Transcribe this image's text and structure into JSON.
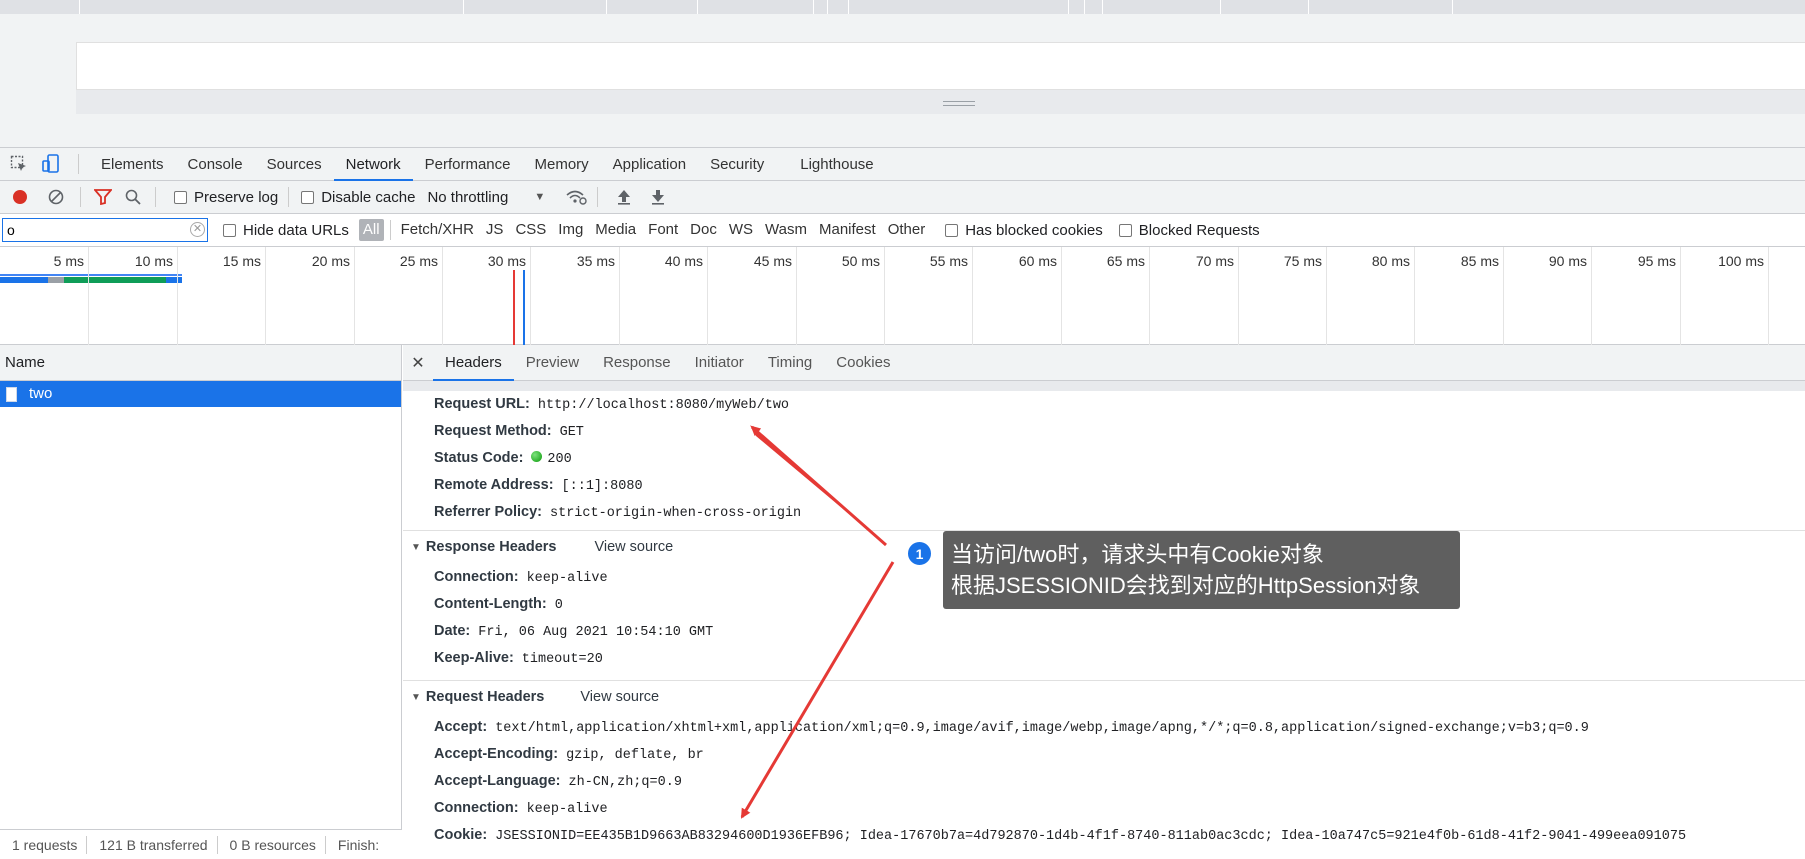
{
  "tabbar": {
    "tabs": [
      "Elements",
      "Console",
      "Sources",
      "Network",
      "Performance",
      "Memory",
      "Application",
      "Security",
      "Lighthouse"
    ],
    "active": "Network"
  },
  "toolbar": {
    "preserve_log": "Preserve log",
    "disable_cache": "Disable cache",
    "throttling": "No throttling"
  },
  "filterbar": {
    "filter_value": "o",
    "hide_data_urls": "Hide data URLs",
    "types": [
      "All",
      "Fetch/XHR",
      "JS",
      "CSS",
      "Img",
      "Media",
      "Font",
      "Doc",
      "WS",
      "Wasm",
      "Manifest",
      "Other"
    ],
    "has_blocked_cookies": "Has blocked cookies",
    "blocked_requests": "Blocked Requests"
  },
  "timeline": {
    "labels": [
      "5 ms",
      "10 ms",
      "15 ms",
      "20 ms",
      "25 ms",
      "30 ms",
      "35 ms",
      "40 ms",
      "45 ms",
      "50 ms",
      "55 ms",
      "60 ms",
      "65 ms",
      "70 ms",
      "75 ms",
      "80 ms",
      "85 ms",
      "90 ms",
      "95 ms",
      "100 ms"
    ]
  },
  "reqlist": {
    "header": "Name",
    "rows": [
      "two"
    ]
  },
  "statusbar": {
    "requests": "1 requests",
    "transferred": "121 B transferred",
    "resources": "0 B resources",
    "finish": "Finish:"
  },
  "details": {
    "tabs": [
      "Headers",
      "Preview",
      "Response",
      "Initiator",
      "Timing",
      "Cookies"
    ],
    "general": [
      {
        "k": "Request URL:",
        "v": "http://localhost:8080/myWeb/two"
      },
      {
        "k": "Request Method:",
        "v": "GET"
      },
      {
        "k": "Status Code:",
        "v": "200"
      },
      {
        "k": "Remote Address:",
        "v": "[::1]:8080"
      },
      {
        "k": "Referrer Policy:",
        "v": "strict-origin-when-cross-origin"
      }
    ],
    "response_headers": {
      "title": "Response Headers",
      "view_source": "View source",
      "items": [
        {
          "k": "Connection:",
          "v": "keep-alive"
        },
        {
          "k": "Content-Length:",
          "v": "0"
        },
        {
          "k": "Date:",
          "v": "Fri, 06 Aug 2021 10:54:10 GMT"
        },
        {
          "k": "Keep-Alive:",
          "v": "timeout=20"
        }
      ]
    },
    "request_headers": {
      "title": "Request Headers",
      "view_source": "View source",
      "items": [
        {
          "k": "Accept:",
          "v": "text/html,application/xhtml+xml,application/xml;q=0.9,image/avif,image/webp,image/apng,*/*;q=0.8,application/signed-exchange;v=b3;q=0.9"
        },
        {
          "k": "Accept-Encoding:",
          "v": "gzip, deflate, br"
        },
        {
          "k": "Accept-Language:",
          "v": "zh-CN,zh;q=0.9"
        },
        {
          "k": "Connection:",
          "v": "keep-alive"
        },
        {
          "k": "Cookie:",
          "v": "JSESSIONID=EE435B1D9663AB83294600D1936EFB96; Idea-17670b7a=4d792870-1d4b-4f1f-8740-811ab0ac3cdc; Idea-10a747c5=921e4f0b-61d8-41f2-9041-499eea091075"
        }
      ]
    }
  },
  "annotation": {
    "badge": "1",
    "line1": "当访问/two时，请求头中有Cookie对象",
    "line2": "根据JSESSIONID会找到对应的HttpSession对象",
    "color": "#e53935"
  }
}
